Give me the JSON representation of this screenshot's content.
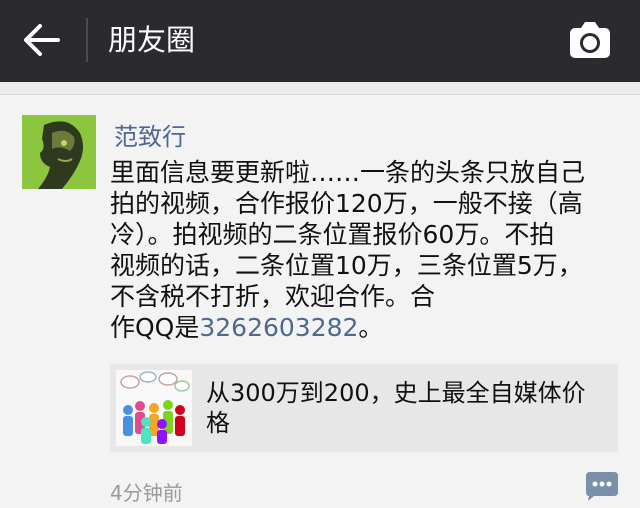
{
  "header": {
    "title": "朋友圈",
    "back_icon": "back-arrow-icon",
    "camera_icon": "camera-icon"
  },
  "post": {
    "author": "范致行",
    "text_lines": [
      "里面信息要更新啦……一条的头条只放自己",
      "拍的视频，合作报价120万，一般不接（高",
      "冷）。拍视频的二条位置报价60万。不拍",
      "视频的话，二条位置10万，三条位置5万，",
      "不含税不打折，欢迎合作。合",
      "作QQ是"
    ],
    "qq_number": "3262603282",
    "text_tail": "。",
    "shared_link": {
      "title_line1": "从300万到200，史上最全自媒体价",
      "title_line2": "格"
    },
    "time": "4分钟前",
    "comment_icon": "comment-icon"
  },
  "colors": {
    "topbar": "#2b2b2f",
    "name_link": "#4f6890",
    "background": "#f3f3f3"
  }
}
